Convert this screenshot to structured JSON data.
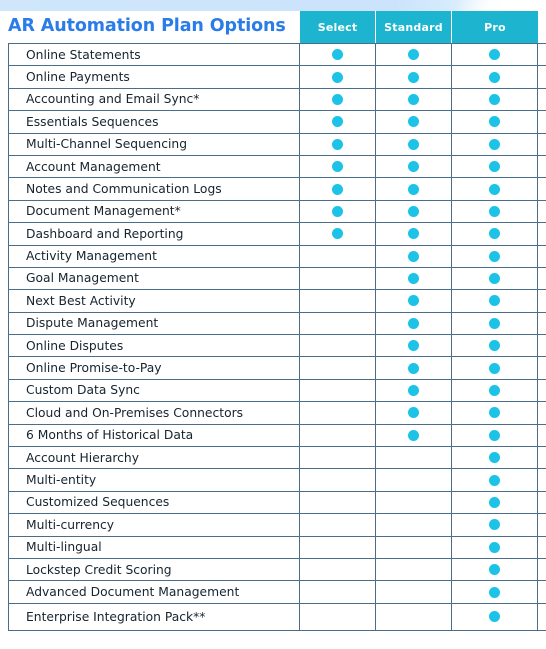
{
  "header": {
    "title": "AR Automation Plan Options",
    "plans": [
      "Select",
      "Standard",
      "Pro"
    ]
  },
  "colors": {
    "title_blue": "#2a7ce9",
    "header_teal": "#1cb4ce",
    "dot_cyan": "#1cc3e6",
    "grid_line": "#4a6d8c",
    "top_band": "#cfe6fb",
    "text": "#16242e"
  },
  "icons": {
    "included": "filled-circle-icon"
  },
  "table": {
    "columns": [
      "AR Automation Plan Options",
      "Select",
      "Standard",
      "Pro"
    ],
    "rows": [
      {
        "feature": "Online Statements",
        "select": true,
        "standard": true,
        "pro": true
      },
      {
        "feature": "Online Payments",
        "select": true,
        "standard": true,
        "pro": true
      },
      {
        "feature": "Accounting and Email Sync*",
        "select": true,
        "standard": true,
        "pro": true
      },
      {
        "feature": "Essentials Sequences",
        "select": true,
        "standard": true,
        "pro": true
      },
      {
        "feature": "Multi-Channel Sequencing",
        "select": true,
        "standard": true,
        "pro": true
      },
      {
        "feature": "Account Management",
        "select": true,
        "standard": true,
        "pro": true
      },
      {
        "feature": "Notes and Communication Logs",
        "select": true,
        "standard": true,
        "pro": true
      },
      {
        "feature": "Document Management*",
        "select": true,
        "standard": true,
        "pro": true
      },
      {
        "feature": "Dashboard and Reporting",
        "select": true,
        "standard": true,
        "pro": true
      },
      {
        "feature": "Activity Management",
        "select": false,
        "standard": true,
        "pro": true
      },
      {
        "feature": "Goal Management",
        "select": false,
        "standard": true,
        "pro": true
      },
      {
        "feature": "Next Best Activity",
        "select": false,
        "standard": true,
        "pro": true
      },
      {
        "feature": "Dispute Management",
        "select": false,
        "standard": true,
        "pro": true
      },
      {
        "feature": "Online Disputes",
        "select": false,
        "standard": true,
        "pro": true
      },
      {
        "feature": "Online Promise-to-Pay",
        "select": false,
        "standard": true,
        "pro": true
      },
      {
        "feature": "Custom Data Sync",
        "select": false,
        "standard": true,
        "pro": true
      },
      {
        "feature": "Cloud and On-Premises Connectors",
        "select": false,
        "standard": true,
        "pro": true
      },
      {
        "feature": "6 Months of Historical Data",
        "select": false,
        "standard": true,
        "pro": true
      },
      {
        "feature": "Account Hierarchy",
        "select": false,
        "standard": false,
        "pro": true
      },
      {
        "feature": "Multi-entity",
        "select": false,
        "standard": false,
        "pro": true
      },
      {
        "feature": "Customized Sequences",
        "select": false,
        "standard": false,
        "pro": true
      },
      {
        "feature": "Multi-currency",
        "select": false,
        "standard": false,
        "pro": true
      },
      {
        "feature": "Multi-lingual",
        "select": false,
        "standard": false,
        "pro": true
      },
      {
        "feature": "Lockstep Credit Scoring",
        "select": false,
        "standard": false,
        "pro": true
      },
      {
        "feature": "Advanced Document Management",
        "select": false,
        "standard": false,
        "pro": true
      },
      {
        "feature": "Enterprise Integration Pack**",
        "select": false,
        "standard": false,
        "pro": true
      }
    ]
  }
}
